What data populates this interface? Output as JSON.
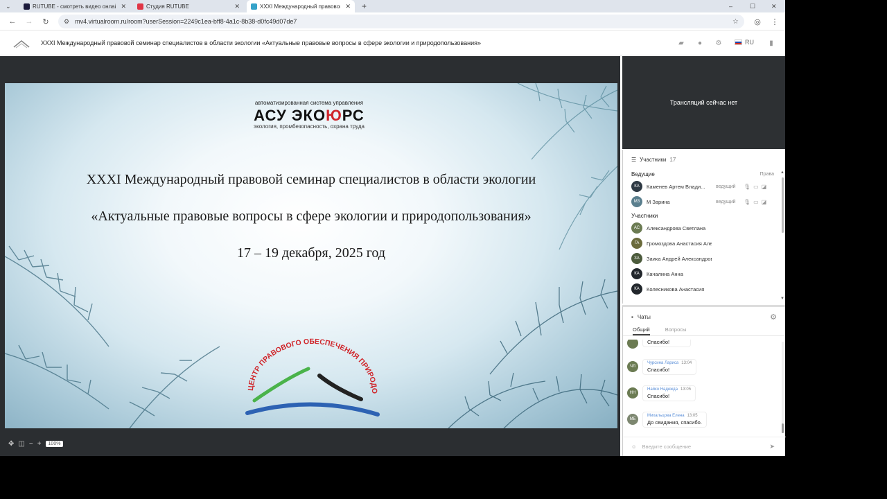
{
  "browser": {
    "tabs": [
      {
        "label": "RUTUBE - смотреть видео онлайн",
        "favicon_color": "#1c1b3c"
      },
      {
        "label": "Студия RUTUBE",
        "favicon_color": "#e03545"
      },
      {
        "label": "XXXI Международный правовой",
        "favicon_color": "#36a3c9"
      }
    ],
    "new_tab": "+",
    "url": "mv4.virtualroom.ru/room?userSession=2249c1ea-bff8-4a1c-8b38-d0fc49d07de7"
  },
  "header": {
    "title": "XXXI Международный правовой семинар специалистов в области экологии «Актуальные правовые вопросы в сфере экологии и природопользования»",
    "lang": "RU"
  },
  "slide": {
    "brand_sub": "автоматизированная система управления",
    "brand_main_a": "АСУ ЭКО",
    "brand_main_b": "Ю",
    "brand_main_c": "РС",
    "brand_tag": "экология, промбезопасность, охрана труда",
    "line1": "XXXI Международный правовой семинар специалистов в области экологии",
    "line2": "«Актуальные правовые вопросы в сфере экологии и природопользования»",
    "line3": "17 – 19 декабря, 2025 год",
    "logo_arc_text": "ЦЕНТР ПРАВОВОГО ОБЕСПЕЧЕНИЯ ПРИРОДОПОЛЬЗОВАНИЯ"
  },
  "zoom": {
    "level": "100%"
  },
  "stream": {
    "status": "Трансляций сейчас нет"
  },
  "participants": {
    "title": "Участники",
    "count": "17",
    "hosts_label": "Ведущие",
    "rights_label": "Права",
    "members_label": "Участники",
    "hosts": [
      {
        "initials": "КА",
        "name": "Каменев Артем Влади...",
        "role": "ведущий",
        "color": "#2f3a44"
      },
      {
        "initials": "МЗ",
        "name": "М Зарина",
        "role": "ведущий",
        "color": "#5b7f8e"
      }
    ],
    "members": [
      {
        "initials": "АС",
        "name": "Александрова Светлана",
        "color": "#6b7b52"
      },
      {
        "initials": "ГА",
        "name": "Громоздова Анастасия Алексеев...",
        "color": "#6b6b3c"
      },
      {
        "initials": "ЗА",
        "name": "Заика Андрей Александрович",
        "color": "#4c5b3c"
      },
      {
        "initials": "КА",
        "name": "Качалина Анна",
        "color": "#22272c"
      },
      {
        "initials": "КА",
        "name": "Колесникова Анастасия",
        "color": "#22272c"
      }
    ]
  },
  "chat": {
    "title": "Чаты",
    "tabs": [
      "Общий",
      "Вопросы"
    ],
    "messages": [
      {
        "initials": "",
        "author": "",
        "time": "",
        "text": "Спасибо!",
        "color": "#6b7b52"
      },
      {
        "initials": "ЧЛ",
        "author": "Чурсина Лариса",
        "time": "13:04",
        "text": "Спасибо!",
        "color": "#6b7b52"
      },
      {
        "initials": "НН",
        "author": "Найко Надежда",
        "time": "13:05",
        "text": "Спасибо!",
        "color": "#6b7b52"
      },
      {
        "initials": "МЕ",
        "author": "Михальцова Елена",
        "time": "13:05",
        "text": "До свидания, спасибо.",
        "color": "#7d8770"
      }
    ],
    "input_placeholder": "Введите сообщение"
  }
}
